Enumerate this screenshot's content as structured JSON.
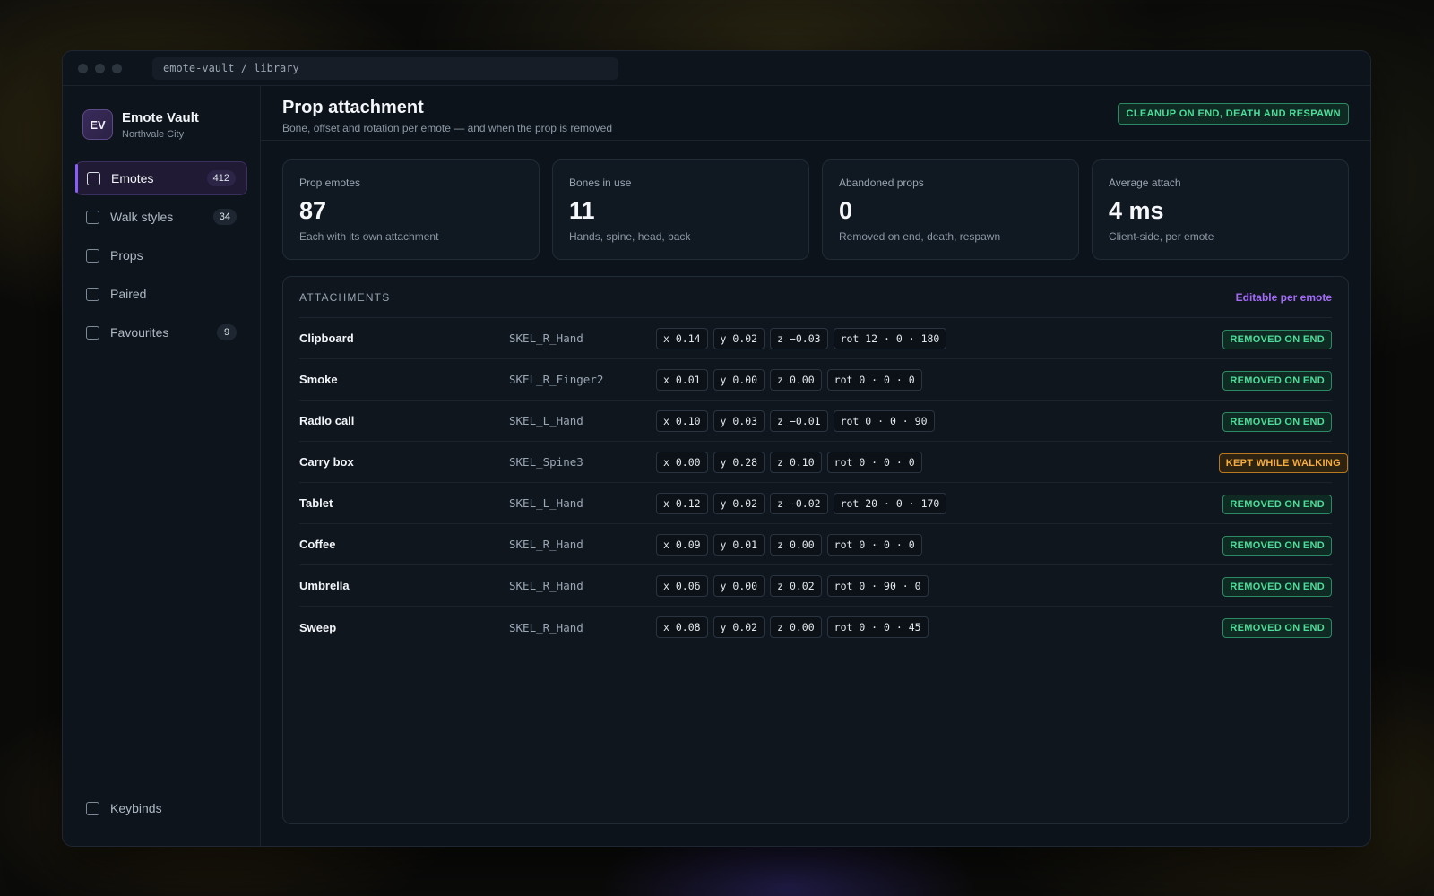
{
  "window": {
    "address": "emote-vault / library"
  },
  "brand": {
    "logo_text": "EV",
    "name": "Emote Vault",
    "subtitle": "Northvale City"
  },
  "sidebar": {
    "items": [
      {
        "label": "Emotes",
        "count": "412",
        "active": true
      },
      {
        "label": "Walk styles",
        "count": "34",
        "active": false
      },
      {
        "label": "Props",
        "count": "",
        "active": false
      },
      {
        "label": "Paired",
        "count": "",
        "active": false
      },
      {
        "label": "Favourites",
        "count": "9",
        "active": false
      }
    ],
    "bottom_item": {
      "label": "Keybinds"
    }
  },
  "header": {
    "title": "Prop attachment",
    "subtitle": "Bone, offset and rotation per emote — and when the prop is removed",
    "pill": "CLEANUP ON END, DEATH AND RESPAWN"
  },
  "stats": [
    {
      "label": "Prop emotes",
      "value": "87",
      "note": "Each with its own attachment"
    },
    {
      "label": "Bones in use",
      "value": "11",
      "note": "Hands, spine, head, back"
    },
    {
      "label": "Abandoned props",
      "value": "0",
      "note": "Removed on end, death, respawn"
    },
    {
      "label": "Average attach",
      "value": "4 ms",
      "note": "Client-side, per emote"
    }
  ],
  "panel": {
    "title": "ATTACHMENTS",
    "link": "Editable per emote",
    "rows": [
      {
        "name": "Clipboard",
        "bone": "SKEL_R_Hand",
        "x": "x 0.14",
        "y": "y 0.02",
        "z": "z −0.03",
        "rot": "rot 12 · 0 · 180",
        "status": "REMOVED ON END",
        "tone": "green"
      },
      {
        "name": "Smoke",
        "bone": "SKEL_R_Finger2",
        "x": "x 0.01",
        "y": "y 0.00",
        "z": "z 0.00",
        "rot": "rot 0 · 0 · 0",
        "status": "REMOVED ON END",
        "tone": "green"
      },
      {
        "name": "Radio call",
        "bone": "SKEL_L_Hand",
        "x": "x 0.10",
        "y": "y 0.03",
        "z": "z −0.01",
        "rot": "rot 0 · 0 · 90",
        "status": "REMOVED ON END",
        "tone": "green"
      },
      {
        "name": "Carry box",
        "bone": "SKEL_Spine3",
        "x": "x 0.00",
        "y": "y 0.28",
        "z": "z 0.10",
        "rot": "rot 0 · 0 · 0",
        "status": "KEPT WHILE WALKING",
        "tone": "amber"
      },
      {
        "name": "Tablet",
        "bone": "SKEL_L_Hand",
        "x": "x 0.12",
        "y": "y 0.02",
        "z": "z −0.02",
        "rot": "rot 20 · 0 · 170",
        "status": "REMOVED ON END",
        "tone": "green"
      },
      {
        "name": "Coffee",
        "bone": "SKEL_R_Hand",
        "x": "x 0.09",
        "y": "y 0.01",
        "z": "z 0.00",
        "rot": "rot 0 · 0 · 0",
        "status": "REMOVED ON END",
        "tone": "green"
      },
      {
        "name": "Umbrella",
        "bone": "SKEL_R_Hand",
        "x": "x 0.06",
        "y": "y 0.00",
        "z": "z 0.02",
        "rot": "rot 0 · 90 · 0",
        "status": "REMOVED ON END",
        "tone": "green"
      },
      {
        "name": "Sweep",
        "bone": "SKEL_R_Hand",
        "x": "x 0.08",
        "y": "y 0.02",
        "z": "z 0.00",
        "rot": "rot 0 · 0 · 45",
        "status": "REMOVED ON END",
        "tone": "green"
      }
    ]
  },
  "colors": {
    "accent": "#8b5cf6",
    "link": "#a36cf7",
    "status_green": "#4ade9a",
    "status_amber": "#f6ad3b"
  }
}
